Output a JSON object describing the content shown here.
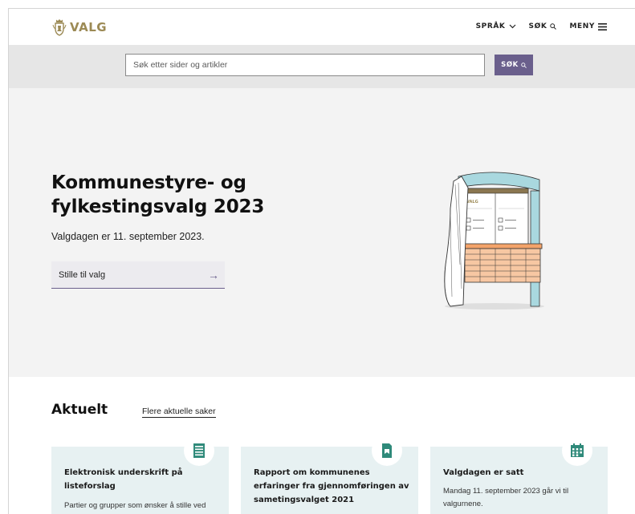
{
  "header": {
    "logo_text": "VALG",
    "nav": {
      "language": "SPRÅK",
      "search": "SØK",
      "menu": "MENY"
    }
  },
  "search": {
    "placeholder": "Søk etter sider og artikler",
    "value": "",
    "button_label": "SØK"
  },
  "hero": {
    "title_line1": "Kommunestyre- og",
    "title_line2": "fylkestingsvalg 2023",
    "subtitle": "Valgdagen er 11. september 2023.",
    "link_label": "Stille til valg",
    "illustration": {
      "sign_text": "VALG"
    }
  },
  "aktuelt": {
    "heading": "Aktuelt",
    "more_link": "Flere aktuelle saker",
    "cards": [
      {
        "icon": "document-list-icon",
        "title": "Elektronisk underskrift på listeforslag",
        "text": "Partier og grupper som ønsker å stille ved"
      },
      {
        "icon": "report-icon",
        "title": "Rapport om kommunenes erfaringer fra gjennomføringen av sametingsvalget 2021",
        "text": ""
      },
      {
        "icon": "calendar-icon",
        "title": "Valgdagen er satt",
        "text": "Mandag 11. september 2023 går vi til valgurnene."
      }
    ]
  },
  "colors": {
    "accent": "#6a5f8c",
    "logo_gold": "#9c8a55",
    "search_band": "#e6e6e6",
    "hero_bg": "#f3f3f3",
    "card_bg": "#e7f1f2",
    "icon_teal": "#2f8a7a"
  }
}
